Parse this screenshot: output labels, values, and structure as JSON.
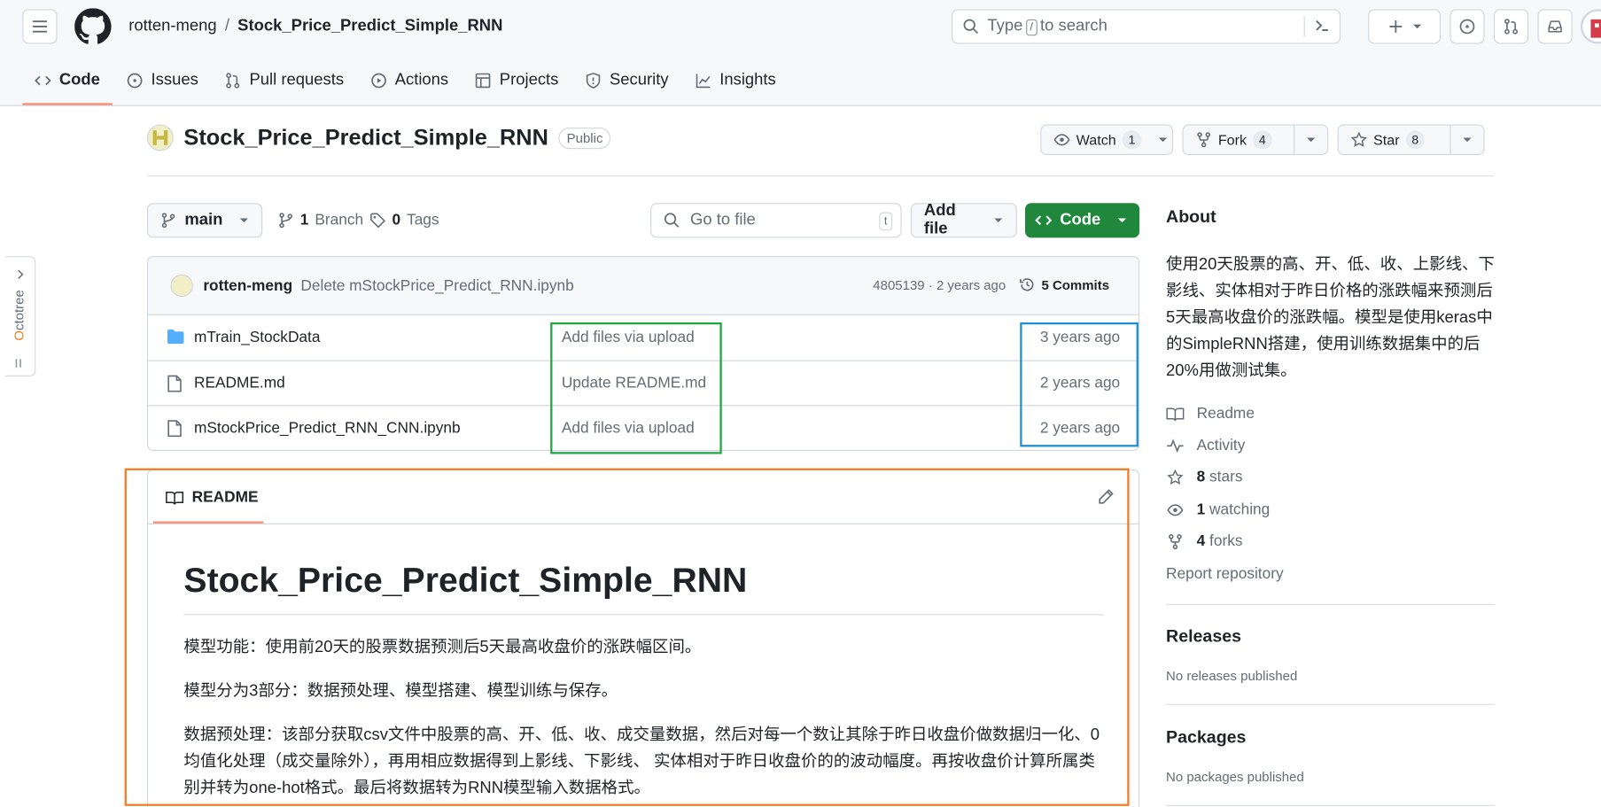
{
  "header": {
    "owner": "rotten-meng",
    "separator": "/",
    "repo": "Stock_Price_Predict_Simple_RNN",
    "search_prefix": "Type",
    "search_key": "/",
    "search_suffix": "to search"
  },
  "tabs": [
    {
      "label": "Code",
      "icon": "code-icon"
    },
    {
      "label": "Issues",
      "icon": "issue-icon"
    },
    {
      "label": "Pull requests",
      "icon": "pull-request-icon"
    },
    {
      "label": "Actions",
      "icon": "play-icon"
    },
    {
      "label": "Projects",
      "icon": "table-icon"
    },
    {
      "label": "Security",
      "icon": "shield-icon"
    },
    {
      "label": "Insights",
      "icon": "graph-icon"
    }
  ],
  "repo": {
    "name": "Stock_Price_Predict_Simple_RNN",
    "visibility": "Public",
    "watch_label": "Watch",
    "watch_count": "1",
    "fork_label": "Fork",
    "fork_count": "4",
    "star_label": "Star",
    "star_count": "8"
  },
  "toolbar": {
    "branch": "main",
    "branches_count": "1",
    "branches_label": "Branch",
    "tags_count": "0",
    "tags_label": "Tags",
    "goto_placeholder": "Go to file",
    "goto_key": "t",
    "add_file": "Add file",
    "code": "Code"
  },
  "commit": {
    "author": "rotten-meng",
    "message": "Delete mStockPrice_Predict_RNN.ipynb",
    "sha_time": "4805139 · 2 years ago",
    "commits_label": "5 Commits"
  },
  "files": [
    {
      "name": "mTrain_StockData",
      "type": "folder",
      "message": "Add files via upload",
      "time": "3 years ago"
    },
    {
      "name": "README.md",
      "type": "file",
      "message": "Update README.md",
      "time": "2 years ago"
    },
    {
      "name": "mStockPrice_Predict_RNN_CNN.ipynb",
      "type": "file",
      "message": "Add files via upload",
      "time": "2 years ago"
    }
  ],
  "readme": {
    "tab_label": "README",
    "title": "Stock_Price_Predict_Simple_RNN",
    "para1": "模型功能：使用前20天的股票数据预测后5天最高收盘价的涨跌幅区间。",
    "para2": "模型分为3部分：数据预处理、模型搭建、模型训练与保存。",
    "para3": "数据预处理：该部分获取csv文件中股票的高、开、低、收、成交量数据，然后对每一个数让其除于昨日收盘价做数据归一化、0均值化处理（成交量除外），再用相应数据得到上影线、下影线、 实体相对于昨日收盘价的的波动幅度。再按收盘价计算所属类别并转为one-hot格式。最后将数据转为RNN模型输入数据格式。"
  },
  "about": {
    "title": "About",
    "description": "使用20天股票的高、开、低、收、上影线、下影线、实体相对于昨日价格的涨跌幅来预测后5天最高收盘价的涨跌幅。模型是使用keras中的SimpleRNN搭建，使用训练数据集中的后20%用做测试集。",
    "readme": "Readme",
    "activity": "Activity",
    "stars_count": "8",
    "stars_label": "stars",
    "watching_count": "1",
    "watching_label": "watching",
    "forks_count": "4",
    "forks_label": "forks",
    "report": "Report repository"
  },
  "releases": {
    "title": "Releases",
    "empty": "No releases published"
  },
  "packages": {
    "title": "Packages",
    "empty": "No packages published"
  },
  "octotree": {
    "prefix": "O",
    "rest": "ctotree"
  },
  "colors": {
    "accent_green": "#1f883d",
    "tab_underline": "#fd8c73",
    "highlight_green": "#22a745",
    "highlight_blue": "#1e90d6",
    "highlight_orange": "#f17d24"
  }
}
